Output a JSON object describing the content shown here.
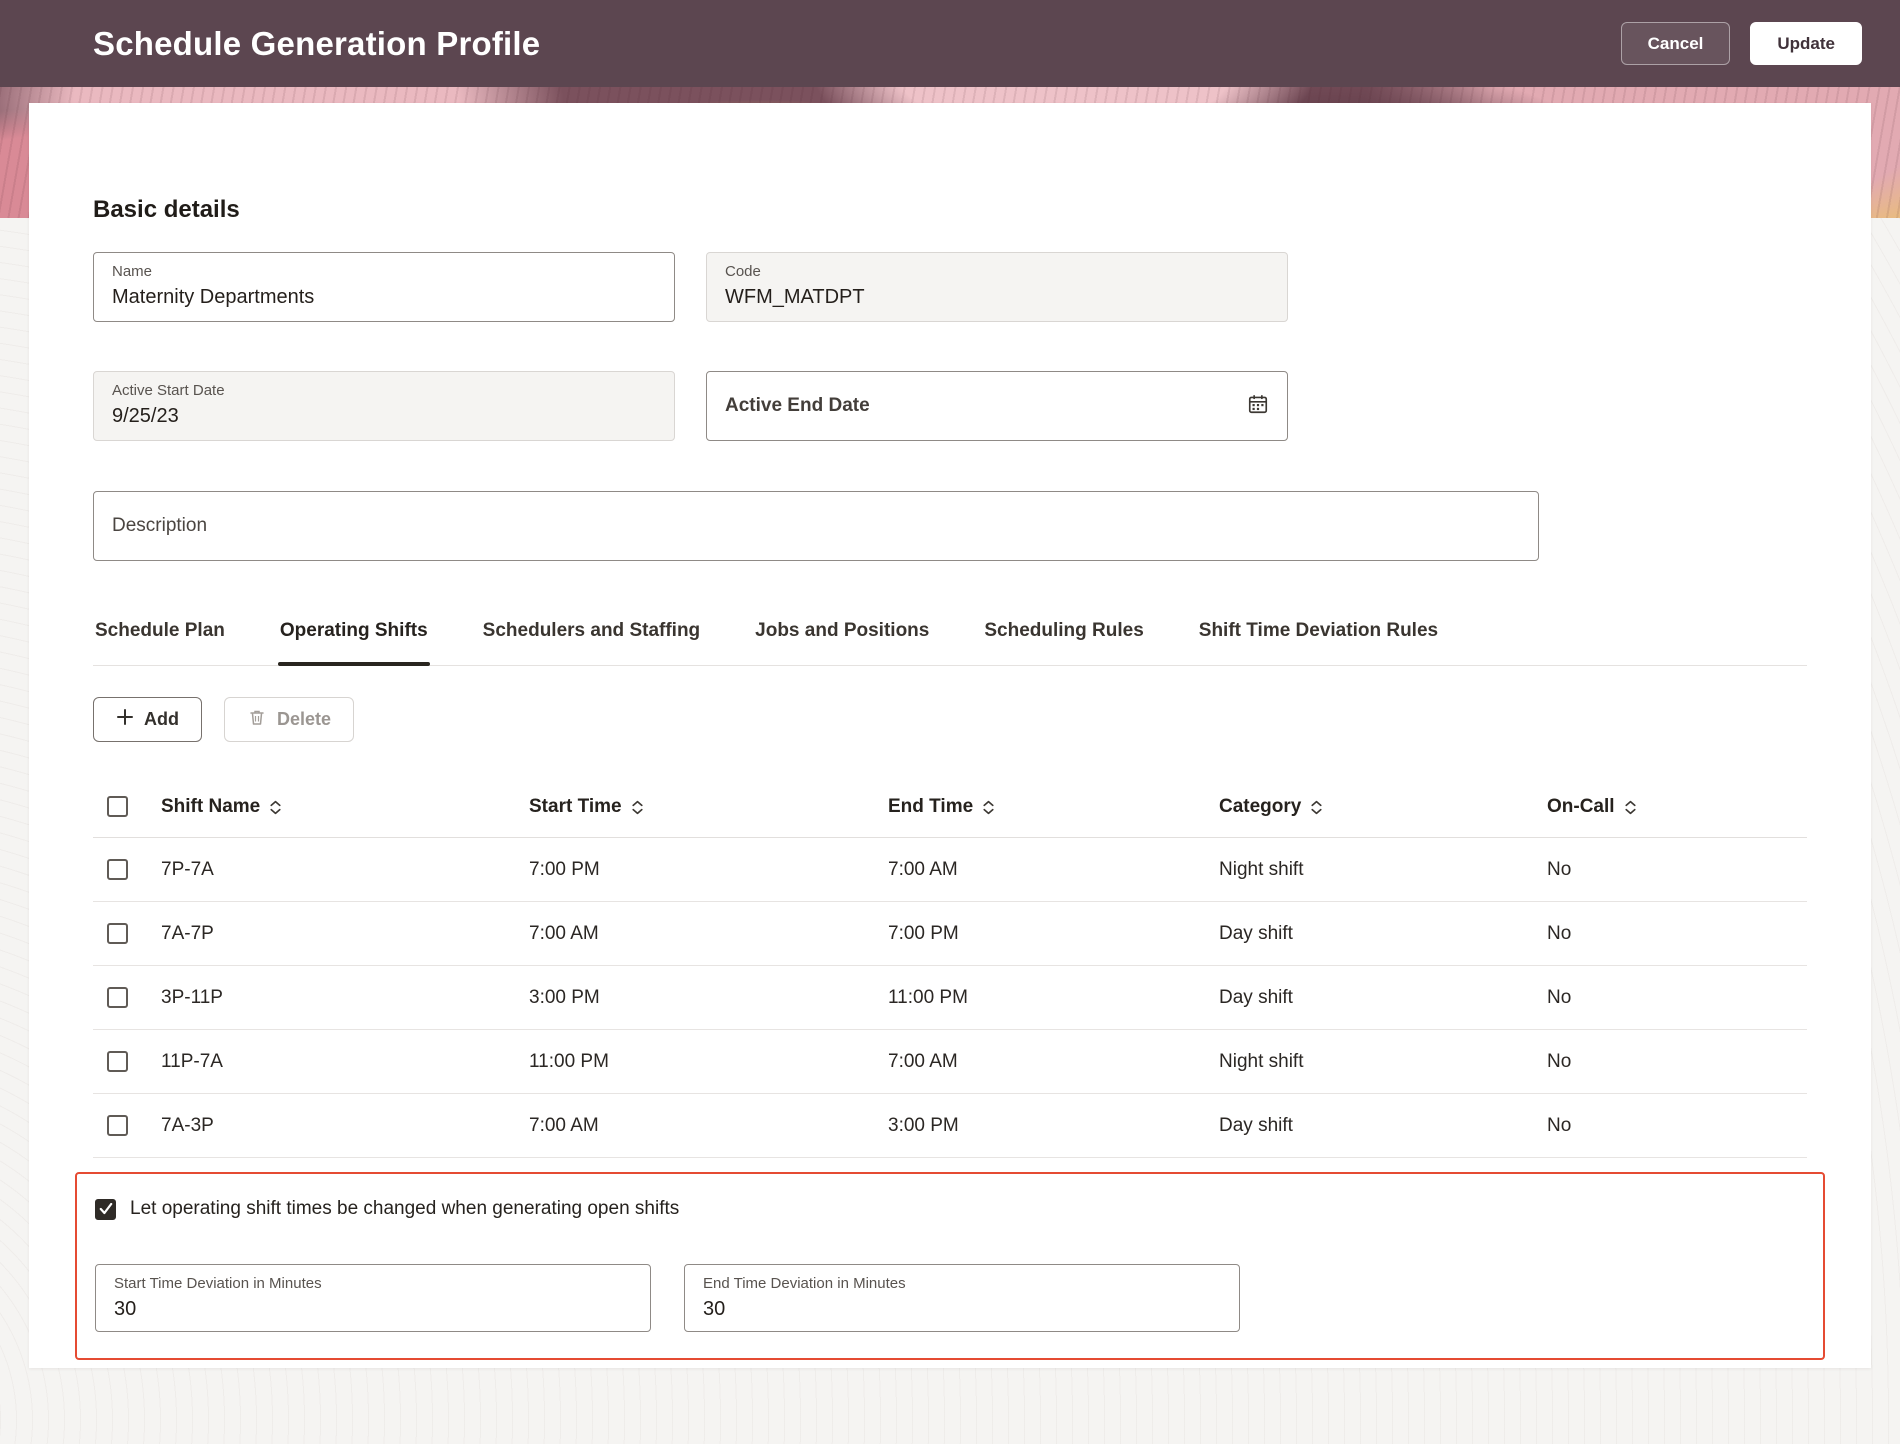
{
  "colors": {
    "header_background": "#5c4650",
    "accent_highlight": "#e54b33",
    "tab_active_underline": "#29251f"
  },
  "header": {
    "title": "Schedule Generation Profile",
    "buttons": {
      "cancel": "Cancel",
      "update": "Update"
    }
  },
  "basic_details": {
    "heading": "Basic details",
    "name": {
      "label": "Name",
      "value": "Maternity Departments"
    },
    "code": {
      "label": "Code",
      "value": "WFM_MATDPT"
    },
    "active_start_date": {
      "label": "Active Start Date",
      "value": "9/25/23"
    },
    "active_end_date": {
      "label": "Active End Date",
      "value": ""
    },
    "description": {
      "label": "Description",
      "value": ""
    }
  },
  "tabs": [
    {
      "label": "Schedule Plan",
      "active": false
    },
    {
      "label": "Operating Shifts",
      "active": true
    },
    {
      "label": "Schedulers and Staffing",
      "active": false
    },
    {
      "label": "Jobs and Positions",
      "active": false
    },
    {
      "label": "Scheduling Rules",
      "active": false
    },
    {
      "label": "Shift Time Deviation Rules",
      "active": false
    }
  ],
  "toolbar": {
    "add": "Add",
    "delete": "Delete"
  },
  "shifts_table": {
    "columns": {
      "shift_name": "Shift Name",
      "start_time": "Start Time",
      "end_time": "End Time",
      "category": "Category",
      "on_call": "On-Call"
    },
    "rows": [
      {
        "shift_name": "7P-7A",
        "start_time": "7:00 PM",
        "end_time": "7:00 AM",
        "category": "Night shift",
        "on_call": "No",
        "selected": false
      },
      {
        "shift_name": "7A-7P",
        "start_time": "7:00 AM",
        "end_time": "7:00 PM",
        "category": "Day shift",
        "on_call": "No",
        "selected": false
      },
      {
        "shift_name": "3P-11P",
        "start_time": "3:00 PM",
        "end_time": "11:00 PM",
        "category": "Day shift",
        "on_call": "No",
        "selected": false
      },
      {
        "shift_name": "11P-7A",
        "start_time": "11:00 PM",
        "end_time": "7:00 AM",
        "category": "Night shift",
        "on_call": "No",
        "selected": false
      },
      {
        "shift_name": "7A-3P",
        "start_time": "7:00 AM",
        "end_time": "3:00 PM",
        "category": "Day shift",
        "on_call": "No",
        "selected": false
      }
    ]
  },
  "open_shift_options": {
    "allow_change_label": "Let operating shift times be changed when generating open shifts",
    "allow_change_checked": true,
    "start_time_deviation": {
      "label": "Start Time Deviation in Minutes",
      "value": "30"
    },
    "end_time_deviation": {
      "label": "End Time Deviation in Minutes",
      "value": "30"
    }
  }
}
